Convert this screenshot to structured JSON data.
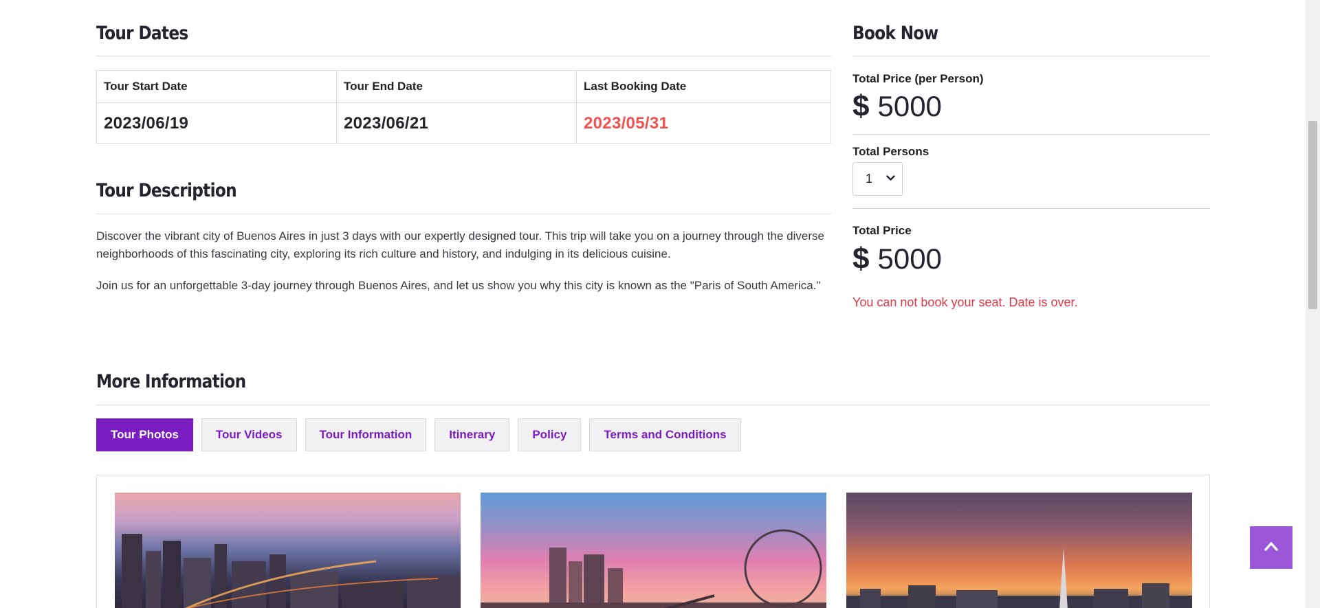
{
  "tour_dates": {
    "heading": "Tour Dates",
    "columns": [
      "Tour Start Date",
      "Tour End Date",
      "Last Booking Date"
    ],
    "values": [
      "2023/06/19",
      "2023/06/21",
      "2023/05/31"
    ],
    "expired_color": "#f05252"
  },
  "tour_description": {
    "heading": "Tour Description",
    "paragraphs": [
      "Discover the vibrant city of Buenos Aires in just 3 days with our expertly designed tour. This trip will take you on a journey through the diverse neighborhoods of this fascinating city, exploring its rich culture and history, and indulging in its delicious cuisine.",
      "Join us for an unforgettable 3-day journey through Buenos Aires, and let us show you why this city is known as the \"Paris of South America.\""
    ]
  },
  "book_now": {
    "heading": "Book Now",
    "price_label": "Total Price (per Person)",
    "currency_symbol": "$",
    "price_value": "5000",
    "persons_label": "Total Persons",
    "persons_selected": "1",
    "total_label": "Total Price",
    "total_value": "5000",
    "error_message": "You can not book your seat. Date is over.",
    "error_color": "#e03a4a"
  },
  "more_information": {
    "heading": "More Information",
    "tabs": [
      "Tour Photos",
      "Tour Videos",
      "Tour Information",
      "Itinerary",
      "Policy",
      "Terms and Conditions"
    ],
    "active_tab": "Tour Photos",
    "accent_color": "#7a1cc0"
  },
  "icons": {
    "dropdown": "chevron-down-icon",
    "back_to_top": "arrow-up-icon"
  }
}
